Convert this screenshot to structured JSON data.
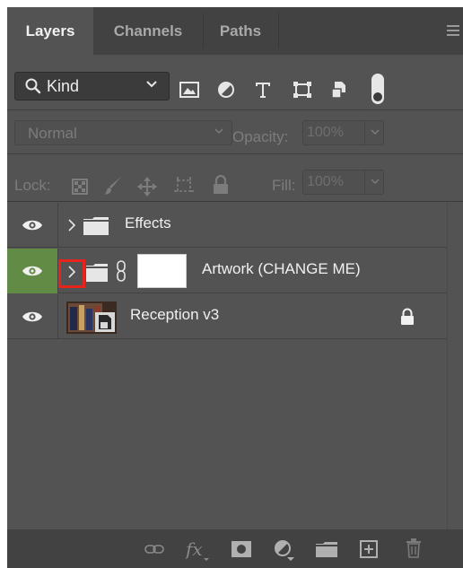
{
  "tabs": [
    {
      "label": "Layers",
      "active": true
    },
    {
      "label": "Channels",
      "active": false
    },
    {
      "label": "Paths",
      "active": false
    }
  ],
  "filter": {
    "kind_label": "Kind",
    "icons": [
      "pixel-filter-icon",
      "adjustment-filter-icon",
      "type-filter-icon",
      "shape-filter-icon",
      "smart-object-filter-icon",
      "filter-toggle-icon"
    ]
  },
  "blend": {
    "mode": "Normal",
    "opacity_label": "Opacity:",
    "opacity_value": "100%"
  },
  "lock": {
    "label": "Lock:",
    "fill_label": "Fill:",
    "fill_value": "100%"
  },
  "layers": [
    {
      "name": "Effects",
      "type": "group",
      "visible": true,
      "selected": false
    },
    {
      "name": "Artwork (CHANGE ME)",
      "type": "group-with-mask",
      "visible": true,
      "selected": true
    },
    {
      "name": "Reception v3",
      "type": "smart-object",
      "visible": true,
      "selected": false,
      "locked": true
    }
  ],
  "colors": {
    "panel_bg": "#535353",
    "tab_bar_bg": "#424242",
    "selected_eye_bg": "#628b45",
    "highlight_box": "#e8231b"
  }
}
